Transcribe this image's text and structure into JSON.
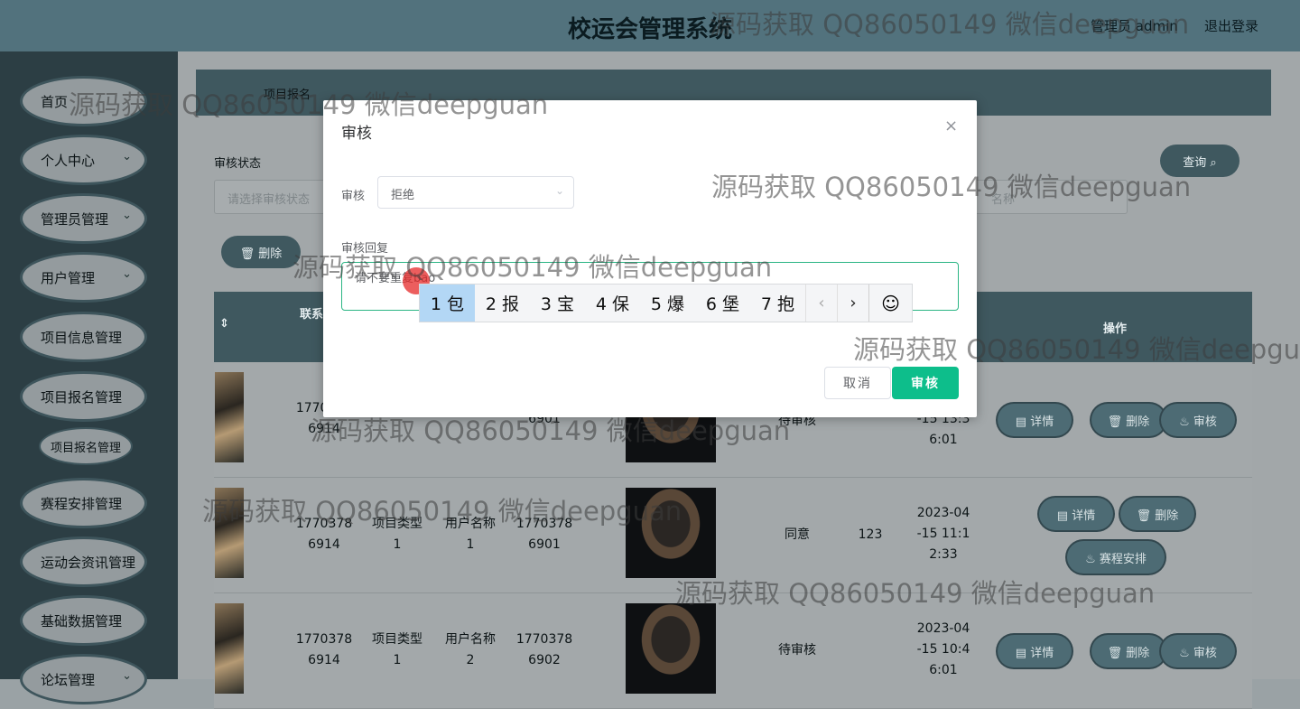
{
  "header": {
    "title": "校运会管理系统",
    "user": "管理员 admin",
    "logout": "退出登录"
  },
  "sidebar": {
    "items": [
      {
        "label": "首页",
        "chevron": ""
      },
      {
        "label": "个人中心",
        "chevron": "⌄"
      },
      {
        "label": "管理员管理",
        "chevron": "⌄"
      },
      {
        "label": "用户管理",
        "chevron": "⌄"
      },
      {
        "label": "项目信息管理",
        "chevron": ""
      },
      {
        "label": "项目报名管理",
        "chevron": ""
      },
      {
        "label": "赛程安排管理",
        "chevron": ""
      },
      {
        "label": "运动会资讯管理",
        "chevron": ""
      },
      {
        "label": "基础数据管理",
        "chevron": ""
      },
      {
        "label": "论坛管理",
        "chevron": "⌄"
      }
    ],
    "sub_item": "项目报名管理"
  },
  "main": {
    "breadcrumb": "项目报名",
    "filter_label": "审核状态",
    "filter_placeholder": "请选择审核状态",
    "right_input_placeholder": "名称",
    "query_button": "查询 ⌕",
    "delete_button": "🗑 删除",
    "columns": [
      "⇕",
      "联系"
    ],
    "op_header": "操作",
    "rows": [
      {
        "phone_a": "1770378\n6914",
        "type": "",
        "name": "",
        "phone_b": "6901",
        "status": "待审核",
        "reply": "",
        "time": "-15 13:3\n6:01"
      },
      {
        "phone_a": "1770378\n6914",
        "type": "项目类型\n1",
        "name": "用户名称\n1",
        "phone_b": "1770378\n6901",
        "status": "同意",
        "reply": "123",
        "time": "2023-04\n-15 11:1\n2:33"
      },
      {
        "phone_a": "1770378\n6914",
        "type": "项目类型\n1",
        "name": "用户名称\n2",
        "phone_b": "1770378\n6902",
        "status": "待审核",
        "reply": "",
        "time": "2023-04\n-15 10:4\n6:01"
      }
    ],
    "actions": {
      "detail": "▤ 详情",
      "delete": "🗑 删除",
      "audit": "♨ 审核",
      "schedule": "♨ 赛程安排"
    }
  },
  "dialog": {
    "title": "审核",
    "close": "×",
    "audit_label": "审核",
    "audit_value": "拒绝",
    "reply_label": "审核回复",
    "reply_value": "请不要重复bao",
    "cancel": "取消",
    "confirm": "审核"
  },
  "ime": {
    "candidates": [
      "1 包",
      "2 报",
      "3 宝",
      "4 保",
      "5 爆",
      "6 堡",
      "7 抱"
    ],
    "prev": "‹",
    "next": "›",
    "emoji": "☺"
  },
  "watermark": "源码获取 QQ86050149 微信deepguan",
  "colors": {
    "header": "#52727d",
    "sidebar": "#2c3e44",
    "accent": "#0dbe8b",
    "ime_selected": "#b3d7f5"
  }
}
